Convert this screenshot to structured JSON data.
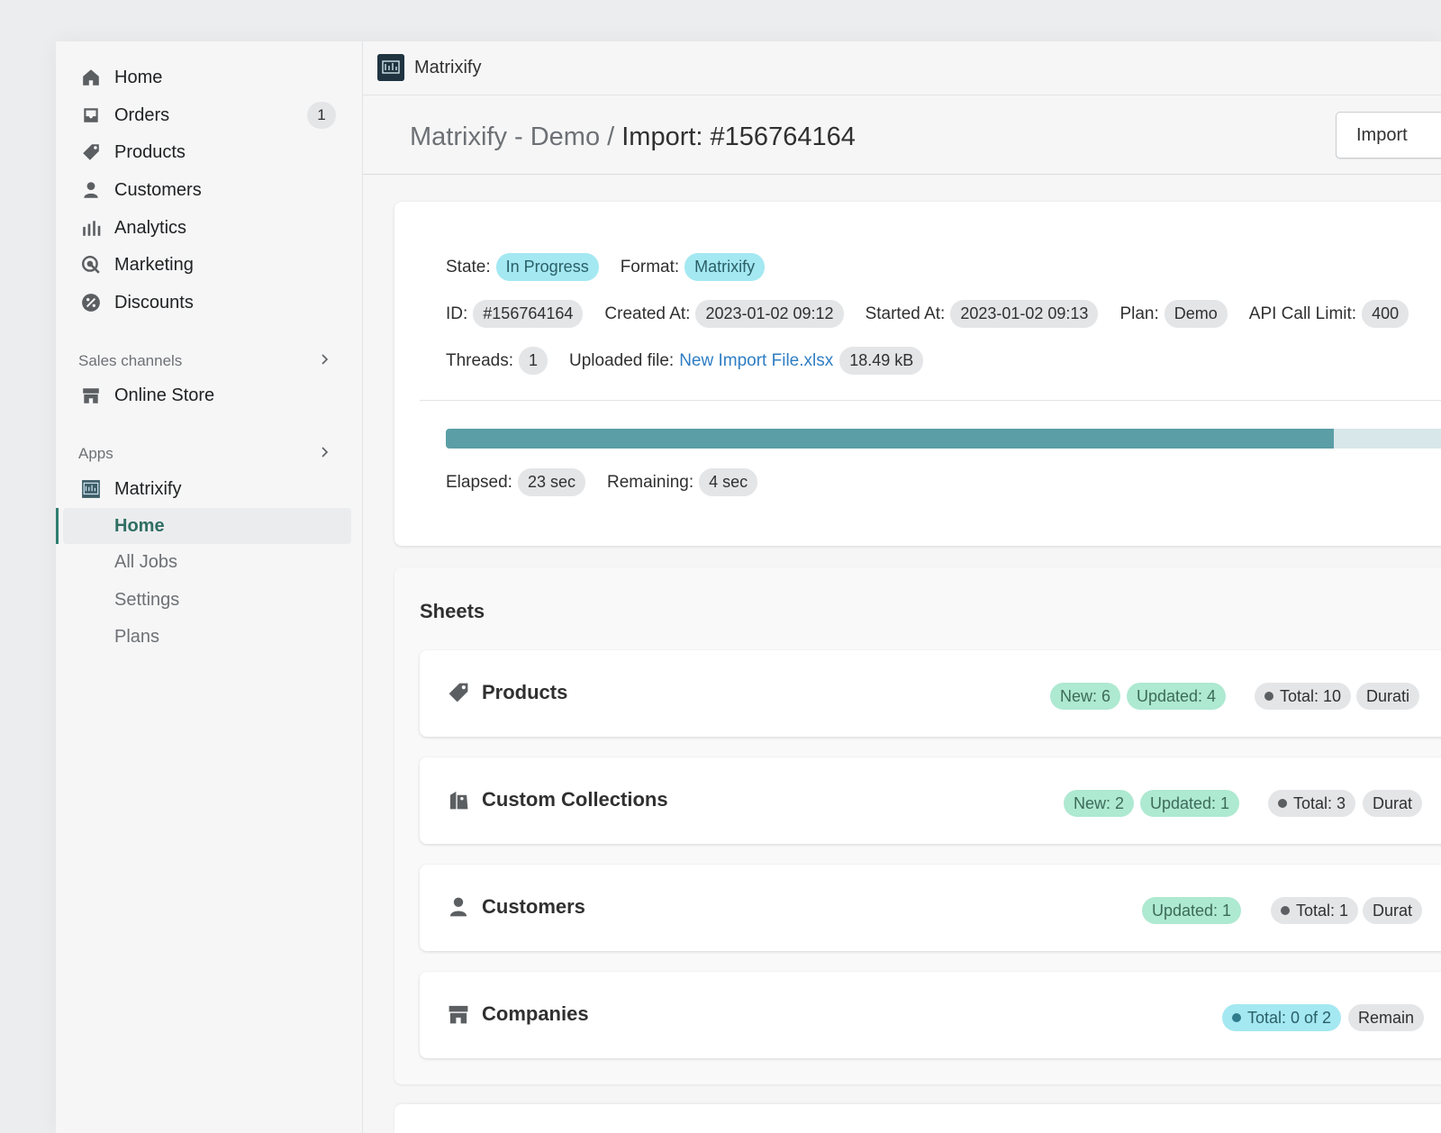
{
  "sidebar": {
    "main_items": [
      {
        "label": "Home",
        "icon": "home-icon"
      },
      {
        "label": "Orders",
        "icon": "orders-icon",
        "badge": "1"
      },
      {
        "label": "Products",
        "icon": "tag-icon"
      },
      {
        "label": "Customers",
        "icon": "person-icon"
      },
      {
        "label": "Analytics",
        "icon": "bar-chart-icon"
      },
      {
        "label": "Marketing",
        "icon": "target-icon"
      },
      {
        "label": "Discounts",
        "icon": "discount-icon"
      }
    ],
    "sales_channels_title": "Sales channels",
    "online_store": "Online Store",
    "apps_title": "Apps",
    "app_name": "Matrixify",
    "app_sub_items": [
      "Home",
      "All Jobs",
      "Settings",
      "Plans"
    ]
  },
  "topbar": {
    "app_title": "Matrixify"
  },
  "page": {
    "breadcrumb_parent": "Matrixify - Demo",
    "breadcrumb_sep": " / ",
    "breadcrumb_current": "Import: #156764164",
    "import_button": "Import"
  },
  "job": {
    "state_label": "State:",
    "state_value": "In Progress",
    "format_label": "Format:",
    "format_value": "Matrixify",
    "id_label": "ID:",
    "id_value": "#156764164",
    "created_label": "Created At:",
    "created_value": "2023-01-02 09:12",
    "started_label": "Started At:",
    "started_value": "2023-01-02 09:13",
    "plan_label": "Plan:",
    "plan_value": "Demo",
    "api_label": "API Call Limit:",
    "api_value": "400",
    "threads_label": "Threads:",
    "threads_value": "1",
    "file_label": "Uploaded file:",
    "file_name": "New Import File.xlsx",
    "file_size": "18.49 kB",
    "progress": 0.85,
    "elapsed_label": "Elapsed:",
    "elapsed_value": "23 sec",
    "remaining_label": "Remaining:",
    "remaining_value": "4 sec"
  },
  "sheets": {
    "title": "Sheets",
    "items": [
      {
        "name": "Products",
        "new": "New: 6",
        "updated": "Updated: 4",
        "total": "Total: 10",
        "duration": "Durati"
      },
      {
        "name": "Custom Collections",
        "new": "New: 2",
        "updated": "Updated: 1",
        "total": "Total: 3",
        "duration": "Durat"
      },
      {
        "name": "Customers",
        "updated": "Updated: 1",
        "total": "Total: 1",
        "duration": "Durat"
      },
      {
        "name": "Companies",
        "total": "Total: 0 of 2",
        "remaining": "Remain"
      }
    ]
  },
  "colors": {
    "accent": "#5b9ea6",
    "info_badge": "#a4e8f2",
    "success_badge": "#aee9d1"
  }
}
